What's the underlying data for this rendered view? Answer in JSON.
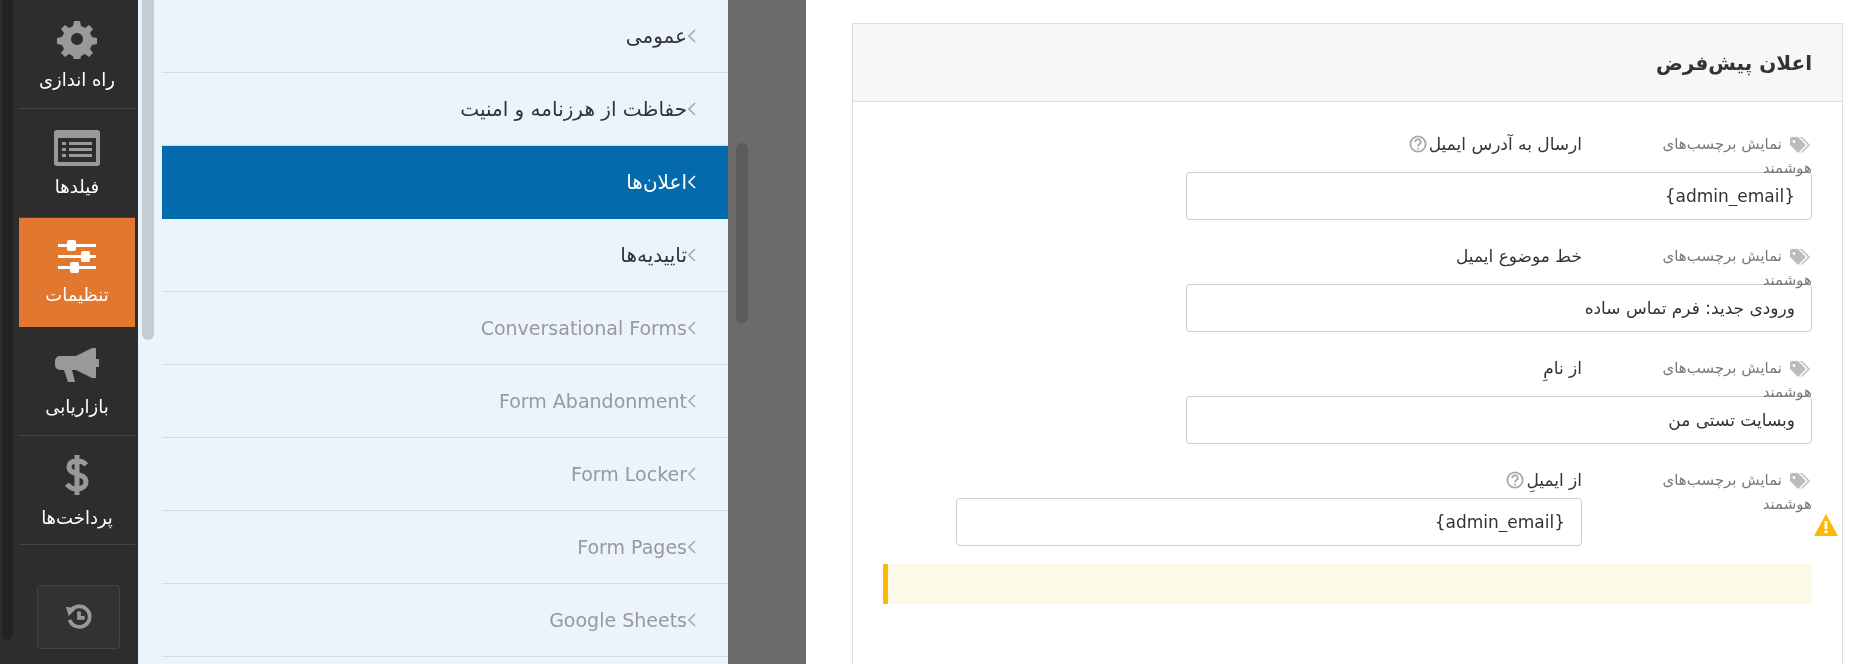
{
  "sidebar": {
    "items": [
      {
        "kind": "gear",
        "label": "راه اندازی",
        "selected": false
      },
      {
        "kind": "list",
        "label": "فیلدها",
        "selected": false
      },
      {
        "kind": "sliders",
        "label": "تنظیمات",
        "selected": true
      },
      {
        "kind": "megaphone",
        "label": "بازاریابی",
        "selected": false
      },
      {
        "kind": "dollar",
        "label": "پرداخت‌ها",
        "selected": false
      }
    ]
  },
  "menu": {
    "items": [
      {
        "label": "عمومی",
        "selected": false,
        "disabled": false
      },
      {
        "label": "حفاظت از هرزنامه و امنیت",
        "selected": false,
        "disabled": false
      },
      {
        "label": "اعلان‌ها",
        "selected": true,
        "disabled": false
      },
      {
        "label": "تاییدیه‌ها",
        "selected": false,
        "disabled": false
      },
      {
        "label": "Conversational Forms",
        "selected": false,
        "disabled": true
      },
      {
        "label": "Form Abandonment",
        "selected": false,
        "disabled": true
      },
      {
        "label": "Form Locker",
        "selected": false,
        "disabled": true
      },
      {
        "label": "Form Pages",
        "selected": false,
        "disabled": true
      },
      {
        "label": "Google Sheets",
        "selected": false,
        "disabled": true
      }
    ]
  },
  "panel": {
    "title": "اعلان پیش‌فرض",
    "fields": [
      {
        "label": "ارسال به آدرس ایمیل",
        "help": true,
        "smart_tags": "نمایش برچسب‌های هوشمند",
        "value": "{admin_email}",
        "warning": false
      },
      {
        "label": "خط موضوع ایمیل",
        "help": false,
        "smart_tags": "نمایش برچسب‌های هوشمند",
        "value": "ورودی جدید: فرم تماس ساده",
        "warning": false
      },
      {
        "label": "از نامِ",
        "help": false,
        "smart_tags": "نمایش برچسب‌های هوشمند",
        "value": "وبسایت تستی من",
        "warning": false
      },
      {
        "label": "از ایمیلِ",
        "help": true,
        "smart_tags": "نمایش برچسب‌های هوشمند",
        "value": "{admin_email}",
        "warning": true
      }
    ]
  }
}
